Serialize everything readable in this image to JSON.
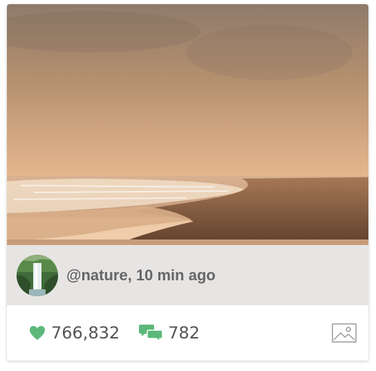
{
  "post": {
    "author_line": "@nature, 10 min ago",
    "likes": "766,832",
    "comments": "782"
  },
  "icons": {
    "like": "heart-icon",
    "comment": "comments-icon",
    "type": "image-icon"
  },
  "colors": {
    "accent": "#5cb87a",
    "text": "#555555",
    "author_text": "#666666"
  }
}
